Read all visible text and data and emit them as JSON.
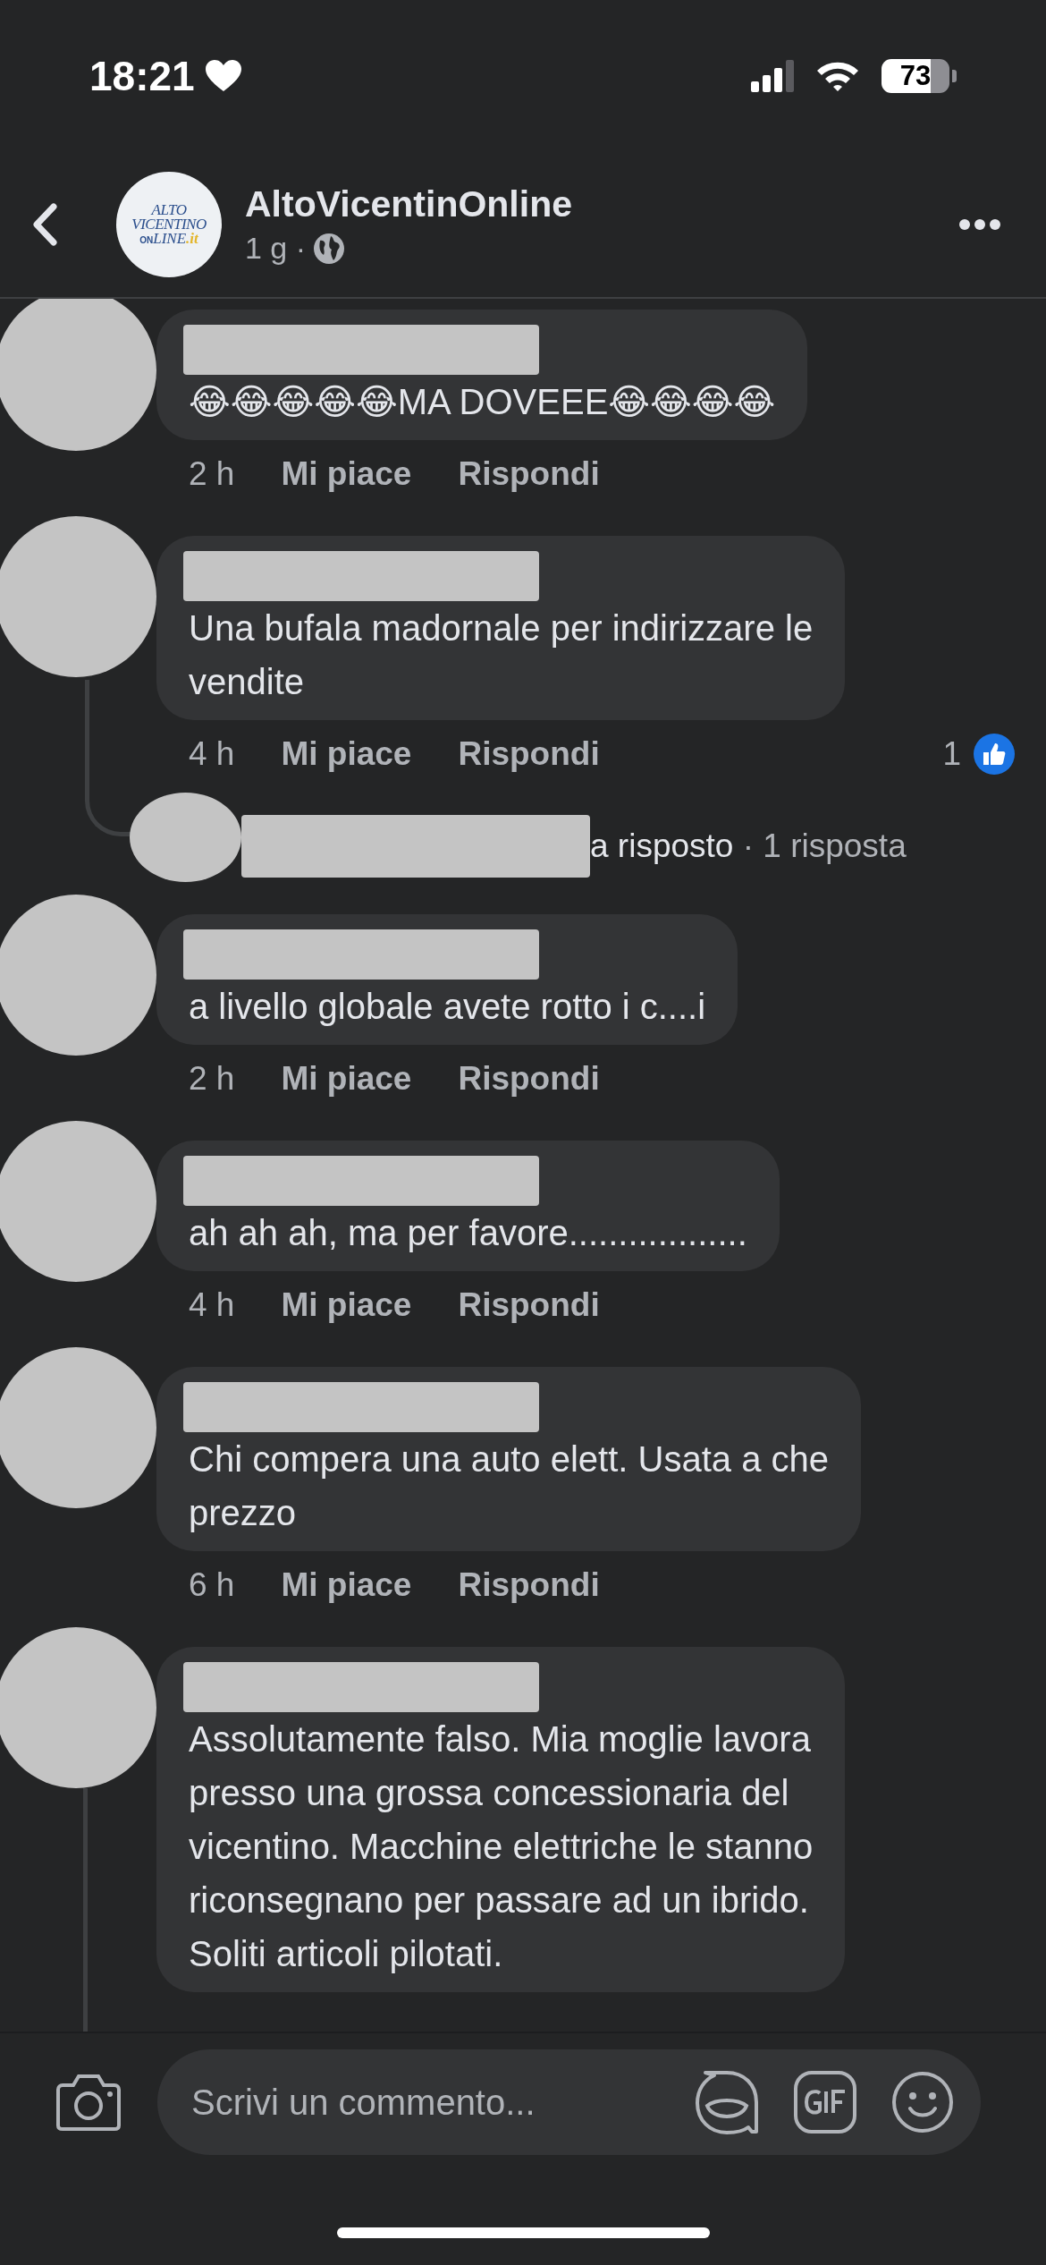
{
  "status_bar": {
    "time": "18:21",
    "battery": "73"
  },
  "header": {
    "title": "AltoVicentinOnline",
    "meta": "1 g ·",
    "logo_lines": [
      "ALTO",
      "VICENTINO"
    ],
    "logo_tail": [
      "ON",
      "LINE",
      ".it"
    ]
  },
  "comments": [
    {
      "text_lines": [
        "😂😂😂😂😂MA DOVEEE😂😂😂😂"
      ],
      "time": "2 h",
      "like": "Mi piace",
      "reply": "Rispondi"
    },
    {
      "text_lines": [
        "Una bufala madornale per indirizzare le",
        "vendite"
      ],
      "time": "4 h",
      "like": "Mi piace",
      "reply": "Rispondi",
      "reaction_count": "1",
      "replies": {
        "text": "a risposto",
        "count": "· 1 risposta"
      }
    },
    {
      "text_lines": [
        "a livello globale avete rotto i c....i"
      ],
      "time": "2 h",
      "like": "Mi piace",
      "reply": "Rispondi"
    },
    {
      "text_lines": [
        "ah ah ah, ma per favore.................."
      ],
      "time": "4 h",
      "like": "Mi piace",
      "reply": "Rispondi"
    },
    {
      "text_lines": [
        "Chi compera una auto elett. Usata a che",
        "prezzo"
      ],
      "time": "6 h",
      "like": "Mi piace",
      "reply": "Rispondi"
    },
    {
      "text_lines": [
        "Assolutamente falso. Mia moglie lavora",
        "presso una grossa concessionaria del",
        "vicentino. Macchine elettriche le stanno",
        "riconsegnano per passare ad un ibrido.",
        "Soliti articoli pilotati."
      ],
      "thread": true
    }
  ],
  "composer": {
    "placeholder": "Scrivi un commento..."
  }
}
